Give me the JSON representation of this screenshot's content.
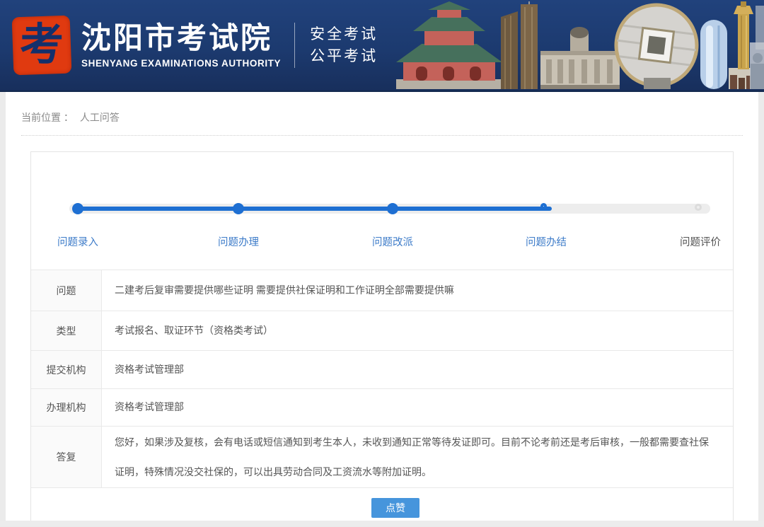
{
  "header": {
    "logo_char": "考",
    "site_title": "沈阳市考试院",
    "site_subtitle": "SHENYANG EXAMINATIONS AUTHORITY",
    "tagline_line1": "安全考试",
    "tagline_line2": "公平考试"
  },
  "breadcrumb": {
    "prefix": "当前位置 ：",
    "current": "人工问答"
  },
  "stepper": {
    "steps": [
      {
        "label": "问题录入",
        "state": "done"
      },
      {
        "label": "问题办理",
        "state": "done"
      },
      {
        "label": "问题改派",
        "state": "done"
      },
      {
        "label": "问题办结",
        "state": "current"
      },
      {
        "label": "问题评价",
        "state": "pending"
      }
    ]
  },
  "details": {
    "rows": [
      {
        "label": "问题",
        "value": "二建考后复审需要提供哪些证明 需要提供社保证明和工作证明全部需要提供嘛"
      },
      {
        "label": "类型",
        "value": "考试报名、取证环节（资格类考试）"
      },
      {
        "label": "提交机构",
        "value": "资格考试管理部"
      },
      {
        "label": "办理机构",
        "value": "资格考试管理部"
      },
      {
        "label": "答复",
        "value": "您好，如果涉及复核，会有电话或短信通知到考生本人，未收到通知正常等待发证即可。目前不论考前还是考后审核，一般都需要查社保证明，特殊情况没交社保的，可以出具劳动合同及工资流水等附加证明。"
      }
    ]
  },
  "actions": {
    "like_label": "点赞"
  },
  "colors": {
    "header_navy": "#1c3a6f",
    "seal_red": "#e03a10",
    "stepper_blue": "#1e6fd2",
    "step_label_blue": "#3e7cc9",
    "button_blue": "#4695dc"
  }
}
